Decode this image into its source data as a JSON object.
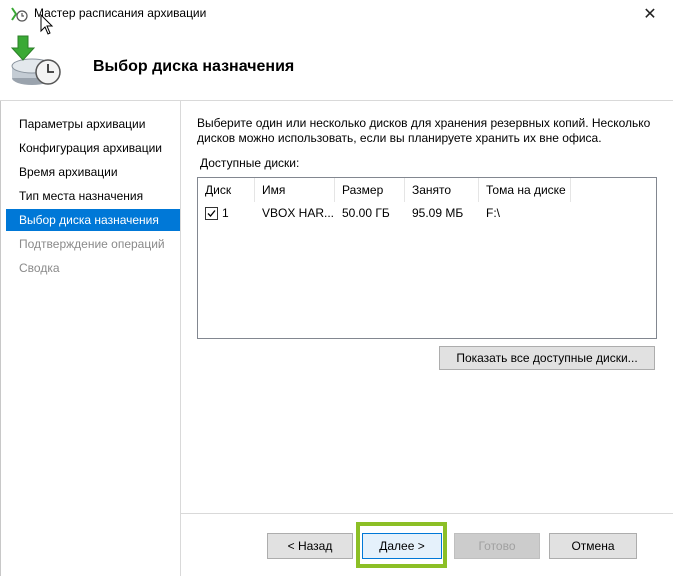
{
  "window": {
    "title": "Мастер расписания архивации",
    "close_glyph": "✕"
  },
  "header": {
    "title": "Выбор диска назначения"
  },
  "nav": {
    "items": [
      {
        "label": "Параметры архивации",
        "state": "normal"
      },
      {
        "label": "Конфигурация архивации",
        "state": "normal"
      },
      {
        "label": "Время архивации",
        "state": "normal"
      },
      {
        "label": "Тип места назначения",
        "state": "normal"
      },
      {
        "label": "Выбор диска назначения",
        "state": "active"
      },
      {
        "label": "Подтверждение операций",
        "state": "disabled"
      },
      {
        "label": "Сводка",
        "state": "disabled"
      }
    ]
  },
  "content": {
    "description": "Выберите один или несколько дисков для хранения резервных копий. Несколько дисков можно использовать, если вы планируете хранить их вне офиса.",
    "disks_label": "Доступные диски:",
    "columns": [
      "Диск",
      "Имя",
      "Размер",
      "Занято",
      "Тома на диске"
    ],
    "rows": [
      {
        "checked": true,
        "disk": "1",
        "name": "VBOX HAR...",
        "size": "50.00 ГБ",
        "used": "95.09 МБ",
        "volumes": "F:\\"
      }
    ],
    "show_all_label": "Показать все доступные диски..."
  },
  "buttons": {
    "back": "< Назад",
    "next": "Далее >",
    "finish": "Готово",
    "cancel": "Отмена"
  },
  "colors": {
    "accent": "#0078d7",
    "highlight": "#8cbf26"
  },
  "icons": {
    "app": "backup-schedule-icon",
    "header": "backup-disk-icon",
    "cursor": "mouse-pointer-icon"
  }
}
